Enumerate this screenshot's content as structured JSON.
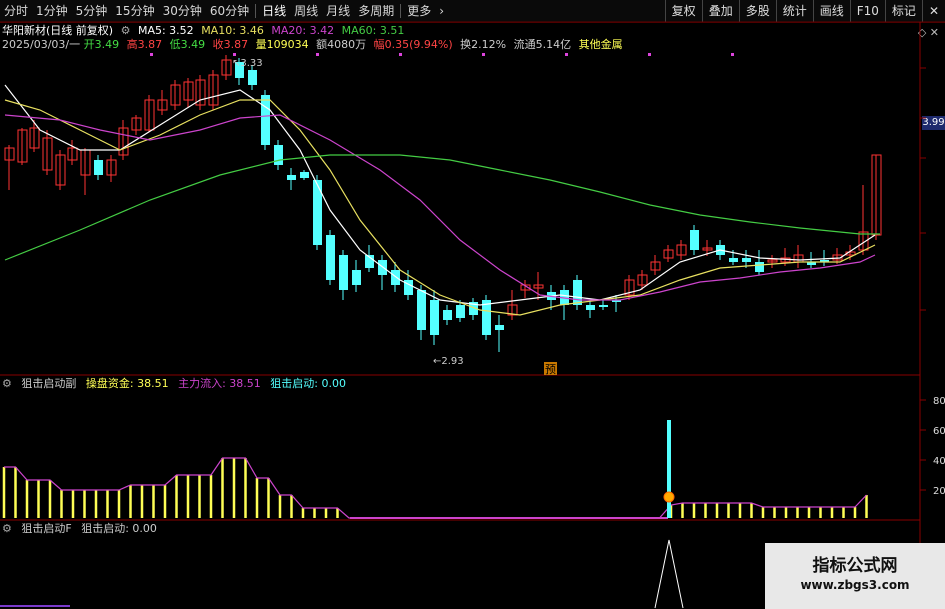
{
  "toolbar": {
    "periods": [
      "分时",
      "1分钟",
      "5分钟",
      "15分钟",
      "30分钟",
      "60分钟",
      "日线",
      "周线",
      "月线",
      "多周期",
      "更多"
    ],
    "active": "日线",
    "right_tools": [
      "复权",
      "叠加",
      "多股",
      "统计",
      "画线",
      "F10",
      "标记"
    ],
    "close_icon": "close-icon"
  },
  "stock": {
    "name": "华阳新材(日线 前复权)",
    "ma5": "MA5: 3.52",
    "ma10": "MA10: 3.46",
    "ma20": "MA20: 3.42",
    "ma60": "MA60: 3.51",
    "date": "2025/03/03/一",
    "open": "开3.49",
    "high": "高3.87",
    "low": "低3.49",
    "close": "收3.87",
    "volume": "量109034",
    "amount": "额4080万",
    "change": "幅0.35(9.94%)",
    "turnover": "换2.12%",
    "float": "流通5.14亿",
    "sector": "其他金属"
  },
  "price_axis": {
    "current_tag": "3.99",
    "high_mark": "3.33",
    "low_mark": "2.93",
    "event_tag": "预"
  },
  "indicator1": {
    "name": "狙击启动副",
    "caopan_label": "操盘资金: 38.51",
    "main_label": "主力流入: 38.51",
    "start_label": "狙击启动: 0.00",
    "axis": [
      "80",
      "60",
      "40",
      "20"
    ]
  },
  "indicator2": {
    "name": "狙击启动F",
    "start_label": "狙击启动: 0.00"
  },
  "colors": {
    "up": "#ff3333",
    "down": "#54ffff",
    "ma5": "#ffffff",
    "ma10": "#e8e060",
    "ma20": "#cc44cc",
    "ma60": "#44cc44",
    "bar": "#ffff55",
    "line_main": "#cc44cc"
  },
  "watermark": {
    "title": "指标公式网",
    "url": "www.zbgs3.com"
  }
}
